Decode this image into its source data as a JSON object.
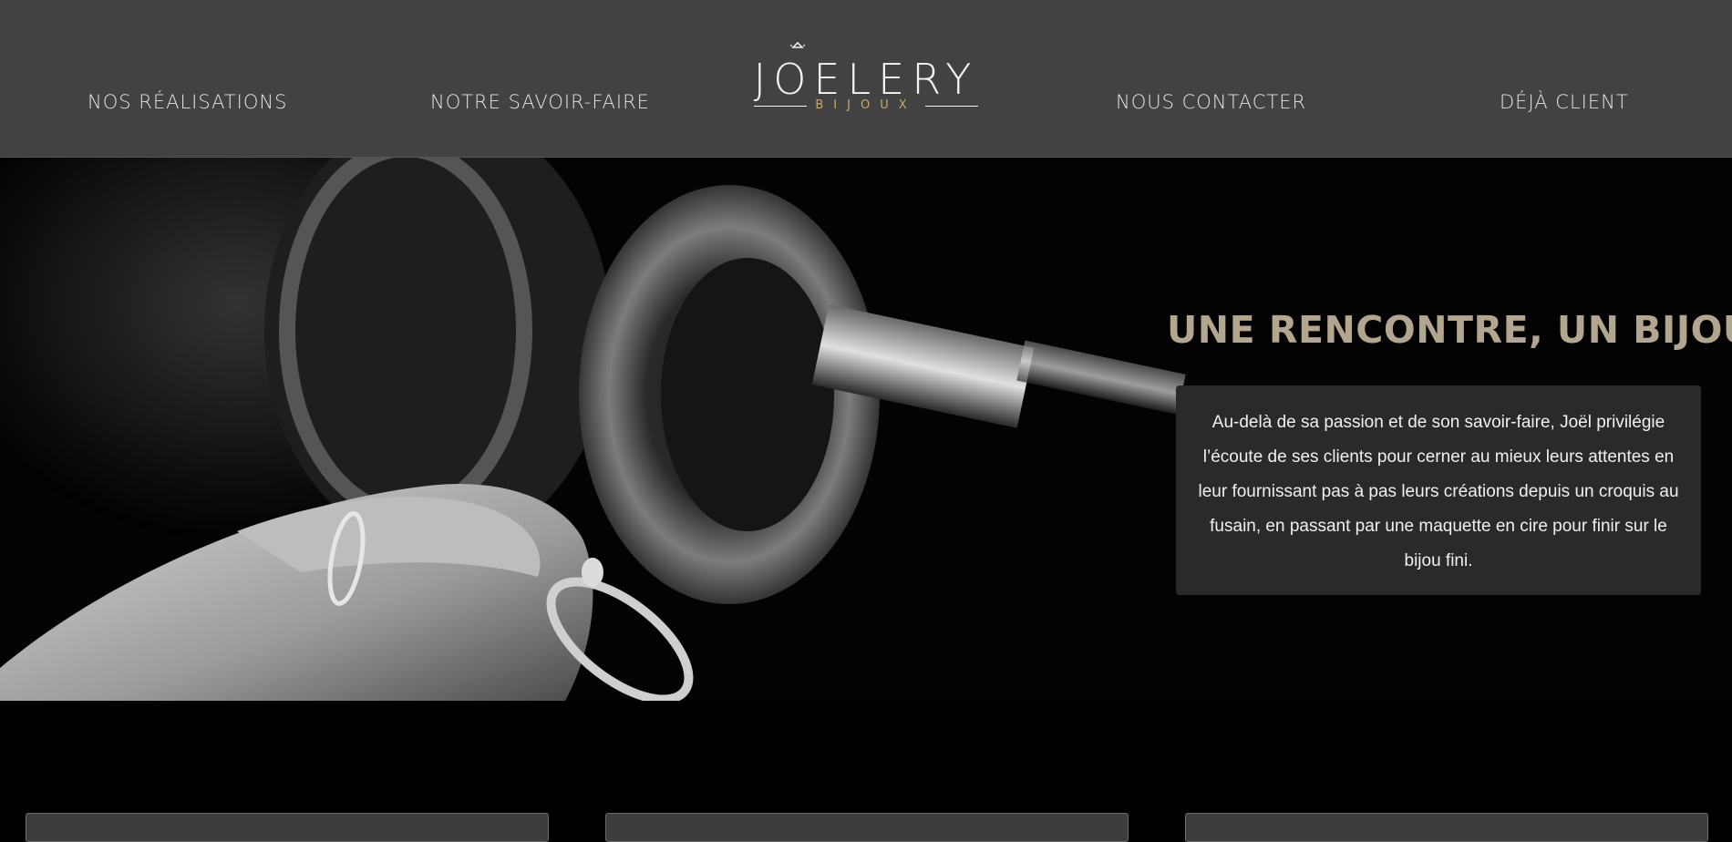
{
  "nav": {
    "items": [
      {
        "label": "NOS RÉALISATIONS"
      },
      {
        "label": "NOTRE SAVOIR-FAIRE"
      },
      {
        "label": "NOUS CONTACTER"
      },
      {
        "label": "DÉJÀ CLIENT"
      }
    ]
  },
  "logo": {
    "word": "JOELERY",
    "sub": "BIJOUX",
    "icon": "ring-icon",
    "accent_color": "#c8a86a"
  },
  "hero": {
    "title": "UNE RENCONTRE, UN BIJOU",
    "text": "Au-delà de sa passion et de son savoir-faire, Joël privilégie l’écoute de ses clients pour cerner au mieux leurs attentes en leur fournissant pas à pas leurs créations depuis un croquis au fusain, en passant par une maquette en cire pour finir sur le bijou fini.",
    "title_color": "#b2a68e"
  },
  "colors": {
    "header_bg": "#424242",
    "page_bg": "#000000",
    "card_bg": "#2a2a2a"
  }
}
